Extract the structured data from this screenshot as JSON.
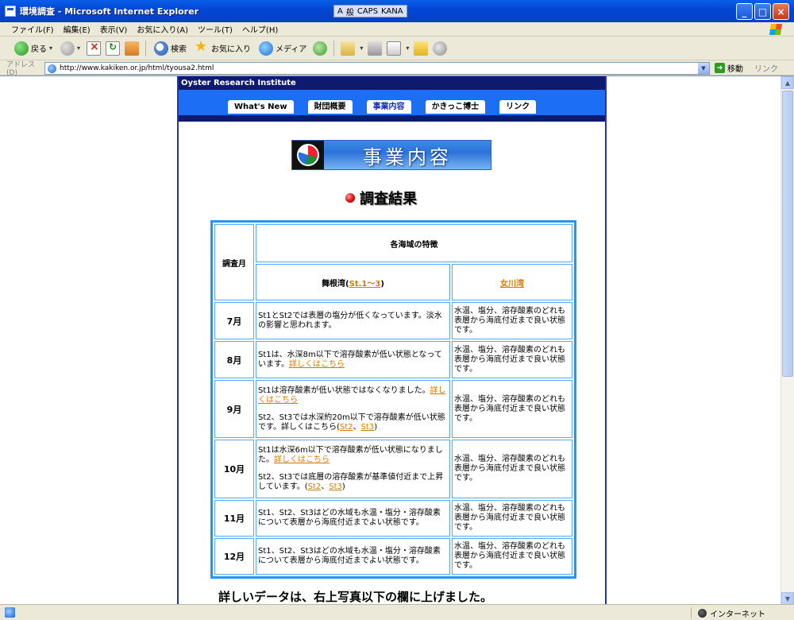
{
  "window": {
    "title": "環境調査 - Microsoft Internet Explorer",
    "ime": [
      "A",
      "般",
      "CAPS",
      "KANA"
    ]
  },
  "menu": [
    "ファイル(F)",
    "編集(E)",
    "表示(V)",
    "お気に入り(A)",
    "ツール(T)",
    "ヘルプ(H)"
  ],
  "toolbar": {
    "back": "戻る",
    "search": "検索",
    "favorites": "お気に入り",
    "media": "メディア"
  },
  "address": {
    "label": "アドレス(D)",
    "url": "http://www.kakiken.or.jp/html/tyousa2.html",
    "go": "移動",
    "links": "リンク"
  },
  "site": {
    "name": "Oyster Research Institute",
    "nav": [
      "What's New",
      "財団概要",
      "事業内容",
      "かきっこ博士",
      "リンク"
    ],
    "banner": "事業内容",
    "heading": "調査結果"
  },
  "table": {
    "month_header": "調査月",
    "features_header": "各海域の特徴",
    "maizuru": {
      "label": "舞根湾(",
      "link": "St.1〜3",
      "close": ")"
    },
    "onagawa": "女川湾",
    "rows": [
      {
        "month": "7月",
        "maizuru": "St1とSt2では表層の塩分が低くなっています。淡水の影響と思われます。",
        "onagawa": "水温、塩分、溶存酸素のどれも表層から海底付近まで良い状態です。"
      },
      {
        "month": "8月",
        "maizuru_text": "St1は、水深8m以下で溶存酸素が低い状態となっています。",
        "maizuru_link": "詳しくはこちら",
        "onagawa": "水温、塩分、溶存酸素のどれも表層から海底付近まで良い状態です。"
      },
      {
        "month": "9月",
        "maizuru_p1": "St1は溶存酸素が低い状態ではなくなりました。",
        "maizuru_link": "詳しくはこちら",
        "maizuru_p2": "St2、St3では水深約20m以下で溶存酸素が低い状態です。詳しくはこちら(",
        "link_st2": "St2",
        "sep": "、",
        "link_st3": "St3",
        "close": ")",
        "onagawa": "水温、塩分、溶存酸素のどれも表層から海底付近まで良い状態です。"
      },
      {
        "month": "10月",
        "maizuru_p1": "St1は水深6m以下で溶存酸素が低い状態になりました。",
        "maizuru_link": "詳しくはこちら",
        "maizuru_p2": "St2、St3では底層の溶存酸素が基準値付近まで上昇しています。(",
        "link_st2": "St2",
        "sep": "、",
        "link_st3": "St3",
        "close": ")",
        "onagawa": "水温、塩分、溶存酸素のどれも表層から海底付近まで良い状態です。"
      },
      {
        "month": "11月",
        "maizuru": "St1、St2、St3はどの水域も水温・塩分・溶存酸素について表層から海底付近までよい状態です。",
        "onagawa": "水温、塩分、溶存酸素のどれも表層から海底付近まで良い状態です。"
      },
      {
        "month": "12月",
        "maizuru": "St1、St2、St3はどの水域も水温・塩分・溶存酸素について表層から海底付近までよい状態です。",
        "onagawa": "水温、塩分、溶存酸素のどれも表層から海底付近まで良い状態です。"
      }
    ]
  },
  "footer": "詳しいデータは、右上写真以下の欄に上げました。",
  "status": {
    "zone": "インターネット"
  },
  "colors": {
    "title_bar": "#0A3EC4",
    "nav_blue": "#1c6ff5",
    "header_navy": "#0d1a6e",
    "table_border": "#2196f3",
    "link": "#d87a00"
  }
}
